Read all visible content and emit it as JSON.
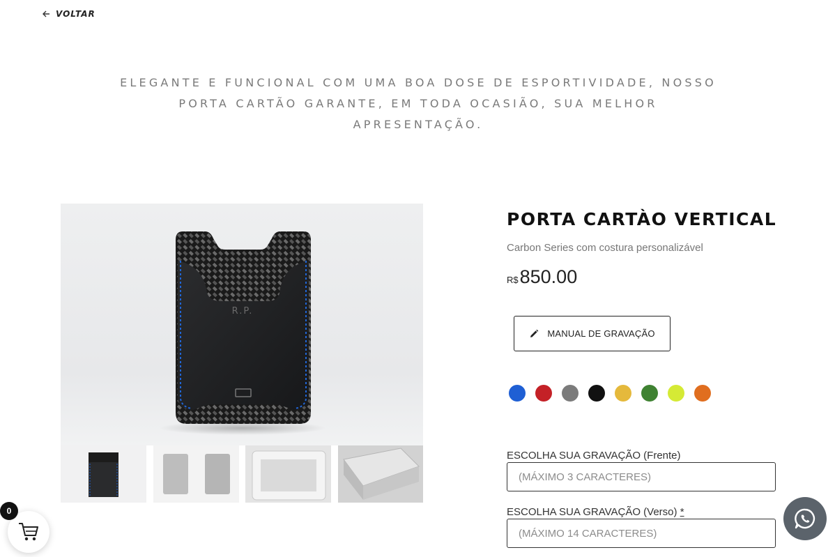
{
  "nav": {
    "back_label": "VOLTAR"
  },
  "tagline": {
    "line1": "ELEGANTE E FUNCIONAL COM UMA BOA DOSE DE ESPORTIVIDADE, NOSSO",
    "line2": "PORTA CARTÃO GARANTE, EM TODA OCASIÃO, SUA MELHOR",
    "line3": "APRESENTAÇÃO."
  },
  "product": {
    "title": "PORTA CARTÀO VERTICAL",
    "subtitle": "Carbon Series com costura personalizável",
    "currency": "R$",
    "price": "850.00",
    "image_monogram": "R.P."
  },
  "manual_button": {
    "label": "MANUAL DE GRAVAÇÃO"
  },
  "colors": [
    {
      "name": "blue",
      "hex": "#1f5fd4"
    },
    {
      "name": "red",
      "hex": "#c42127"
    },
    {
      "name": "gray",
      "hex": "#7b7b7b"
    },
    {
      "name": "black",
      "hex": "#111111"
    },
    {
      "name": "gold",
      "hex": "#e5b93c"
    },
    {
      "name": "green",
      "hex": "#3f8232"
    },
    {
      "name": "lime",
      "hex": "#d5ea35"
    },
    {
      "name": "orange",
      "hex": "#e06e1f"
    }
  ],
  "engraving_front": {
    "label": "ESCOLHA SUA GRAVAÇÃO (Frente)",
    "placeholder": "(MÁXIMO 3 CARACTERES)"
  },
  "engraving_back": {
    "label": "ESCOLHA SUA GRAVAÇÃO (Verso)",
    "required_mark": "*",
    "placeholder": "(MÁXIMO 14 CARACTERES)"
  },
  "cart": {
    "count": "0"
  }
}
